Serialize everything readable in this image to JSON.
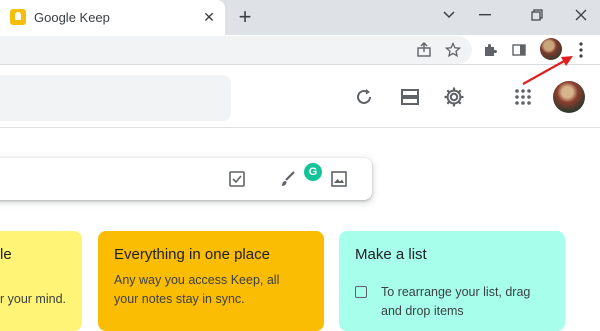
{
  "browser": {
    "tab_title": "Google Keep",
    "tab_close": "✕",
    "new_tab": "+"
  },
  "cards": [
    {
      "title": "le",
      "body": [
        "r your mind."
      ],
      "color": "#fff475"
    },
    {
      "title": "Everything in one place",
      "body": [
        "Any way you access Keep, all",
        "your notes stay in sync."
      ],
      "color": "#fbbc04"
    },
    {
      "title": "Make a list",
      "body": [
        "To rearrange your list, drag",
        "and drop items"
      ],
      "color": "#a7ffeb"
    }
  ],
  "grammarly_badge": "G",
  "colors": {
    "annotation_arrow": "#e02020",
    "keep_brand": "#f6bd0b",
    "grammarly": "#15c39a"
  }
}
